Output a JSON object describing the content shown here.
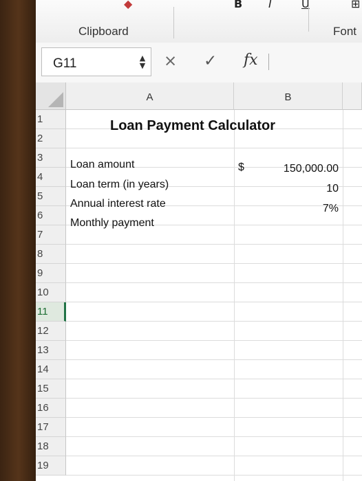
{
  "ribbon": {
    "groups": [
      "Clipboard",
      "Font"
    ],
    "icons": [
      "clipboard-icon",
      "bold-icon",
      "italic-icon",
      "underline-icon",
      "borders-icon"
    ]
  },
  "formula_bar": {
    "name_box": "G11",
    "cancel_icon": "×",
    "enter_icon": "✓",
    "fx_label": "fx",
    "formula": ""
  },
  "sheet": {
    "columns": [
      "A",
      "B"
    ],
    "rows": [
      "1",
      "2",
      "3",
      "4",
      "5",
      "6",
      "7",
      "8",
      "9",
      "10",
      "11",
      "12",
      "13",
      "14",
      "15",
      "16",
      "17",
      "18",
      "19"
    ],
    "selected_row": "11",
    "title": "Loan Payment Calculator",
    "labels": {
      "loan_amount": "Loan amount",
      "loan_term": "Loan term (in years)",
      "interest_rate": "Annual interest rate",
      "monthly_payment": "Monthly payment"
    },
    "values": {
      "currency_symbol": "$",
      "loan_amount": "150,000.00",
      "loan_term": "10",
      "interest_rate": "7%",
      "monthly_payment": ""
    }
  }
}
